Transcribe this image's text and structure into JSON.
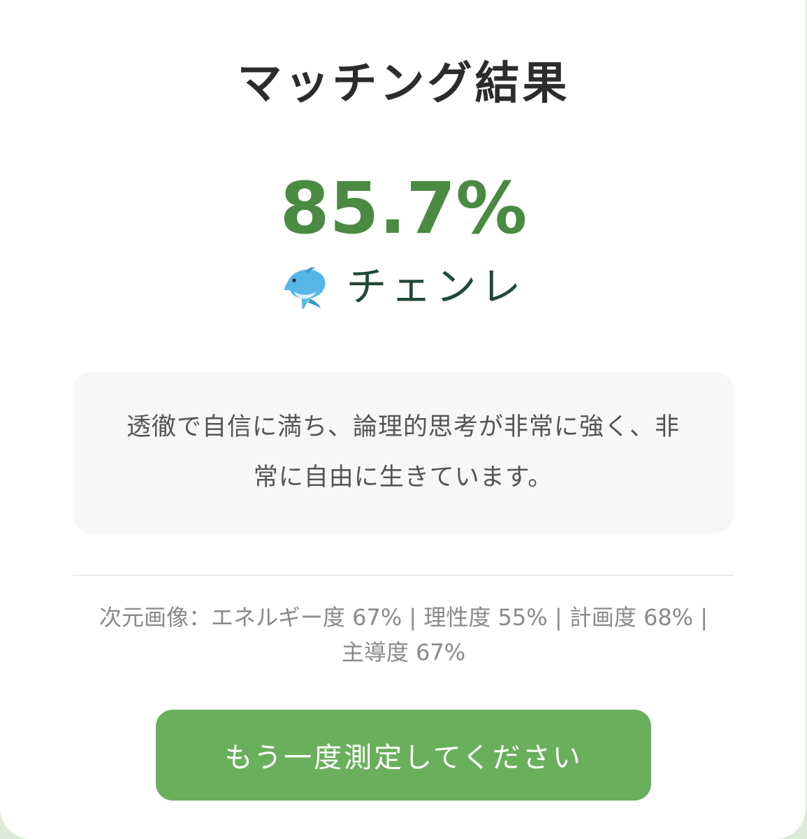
{
  "title": "マッチング結果",
  "score": "85.7%",
  "result_type": {
    "emoji_icon": "dolphin-icon",
    "name": "チェンレ"
  },
  "description": "透徹で自信に満ち、論理的思考が非常に強く、非常に自由に生きています。",
  "dimensions": "次元画像：エネルギー度 67% | 理性度 55% | 計画度 68% | 主導度 67%",
  "retry_button_label": "もう一度測定してください",
  "colors": {
    "score": "#4a8a43",
    "button": "#6aaf5c",
    "background": "#dcebd8",
    "type_name": "#214a36"
  }
}
